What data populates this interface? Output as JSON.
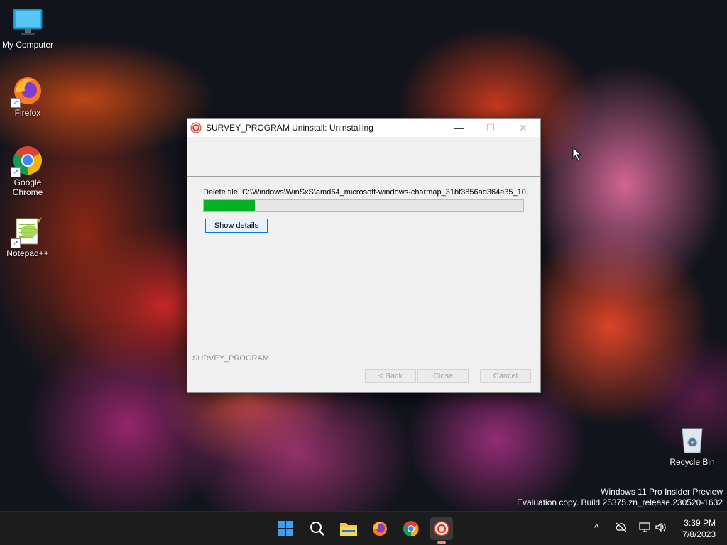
{
  "desktop": {
    "icons": [
      {
        "label": "My Computer"
      },
      {
        "label": "Firefox"
      },
      {
        "label": "Google Chrome"
      },
      {
        "label": "Notepad++"
      },
      {
        "label": "Recycle Bin"
      }
    ],
    "watermark": {
      "line1": "Windows 11 Pro Insider Preview",
      "line2": "Evaluation copy. Build 25375.zn_release.230520-1632"
    }
  },
  "installer": {
    "title": "SURVEY_PROGRAM Uninstall: Uninstalling",
    "status_text": "Delete file: C:\\Windows\\WinSxS\\amd64_microsoft-windows-charmap_31bf3856ad364e35_10.",
    "progress_fraction": 0.16,
    "show_details_label": "Show details",
    "brand_text": "SURVEY_PROGRAM",
    "back_label": "< Back",
    "close_label": "Close",
    "cancel_label": "Cancel",
    "minimize_glyph": "—",
    "maximize_glyph": "☐",
    "close_glyph": "✕"
  },
  "taskbar": {
    "icons": [
      "start-icon",
      "search-icon",
      "file-explorer-icon",
      "firefox-icon",
      "chrome-icon",
      "survey-program-icon"
    ],
    "tray": {
      "chevron": "^",
      "time": "3:39 PM",
      "date": "7/8/2023"
    }
  },
  "colors": {
    "progress_fill": "#06b025",
    "primary_border": "#0078d7",
    "taskbar_bg": "#1c1c1c"
  }
}
